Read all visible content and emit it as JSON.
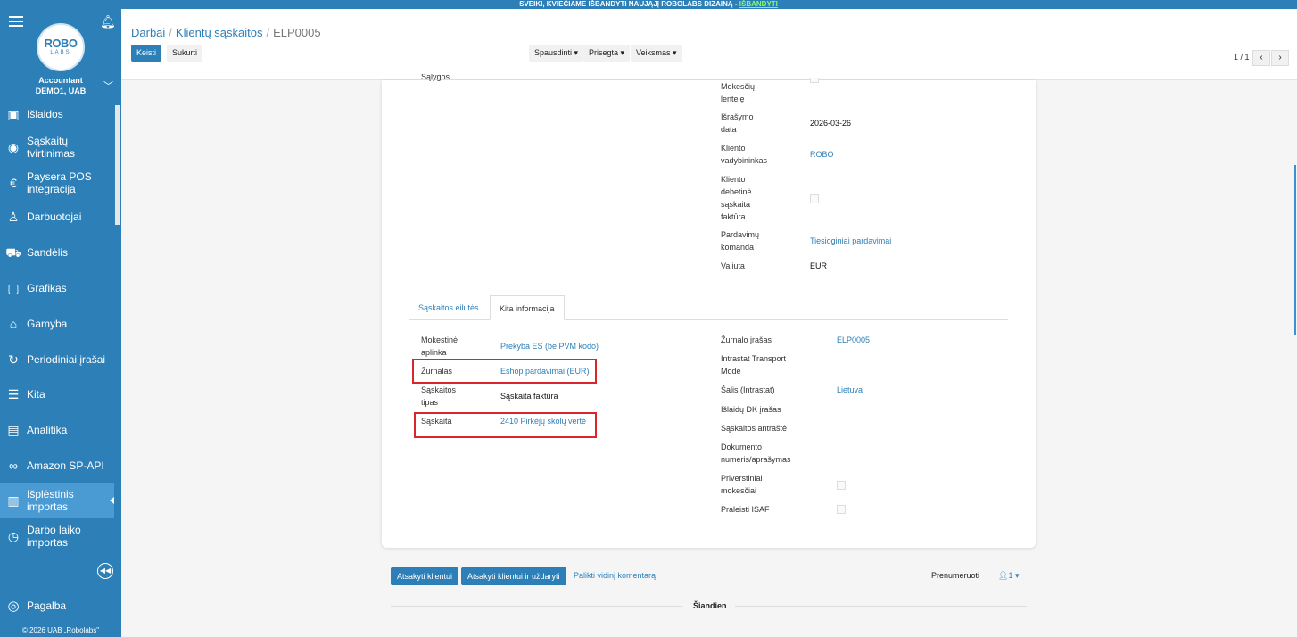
{
  "banner": {
    "text": "SVEIKI, KVIEČIAME IŠBANDYTI NAUJĄJĮ ROBOLABS DIZAINĄ - ",
    "link": "IŠBANDYTI"
  },
  "sidebar": {
    "logo_top": "ROBO",
    "logo_bottom": "LABS",
    "account_role": "Accountant",
    "account_company": "DEMO1, UAB",
    "items": [
      {
        "label": "Išlaidos",
        "icon": "receipt-icon"
      },
      {
        "label": "Sąskaitų tvirtinimas",
        "icon": "eye-icon"
      },
      {
        "label": "Paysera POS integracija",
        "icon": "euro-card-icon"
      },
      {
        "label": "Darbuotojai",
        "icon": "user-icon"
      },
      {
        "label": "Sandėlis",
        "icon": "truck-icon"
      },
      {
        "label": "Grafikas",
        "icon": "calendar-user-icon"
      },
      {
        "label": "Gamyba",
        "icon": "factory-icon"
      },
      {
        "label": "Periodiniai įrašai",
        "icon": "refresh-icon"
      },
      {
        "label": "Kita",
        "icon": "list-icon"
      },
      {
        "label": "Analitika",
        "icon": "analytics-icon"
      },
      {
        "label": "Amazon SP-API",
        "icon": "link-icon"
      },
      {
        "label": "Išplėstinis importas",
        "icon": "import-icon"
      },
      {
        "label": "Darbo laiko importas",
        "icon": "clock-icon"
      }
    ],
    "help": "Pagalba",
    "copyright": "© 2026 UAB „Robolabs\""
  },
  "header": {
    "breadcrumb": [
      "Darbai",
      "Klientų sąskaitos",
      "ELP0005"
    ],
    "edit": "Keisti",
    "create": "Sukurti",
    "print": "Spausdinti",
    "attached": "Prisegta",
    "actions": "Veiksmas",
    "pager": "1 / 1"
  },
  "upper_fields": {
    "left_partial": "Sąlygos",
    "tax_table": "Mokesčių lentelę",
    "invoice_date_label": "Išrašymo data",
    "invoice_date": "2026-03-26",
    "manager_label": "Kliento vadybininkas",
    "manager": "ROBO",
    "debit_label": "Kliento debetinė sąskaita faktūra",
    "team_label": "Pardavimų komanda",
    "team": "Tiesioginiai pardavimai",
    "currency_label": "Valiuta",
    "currency": "EUR"
  },
  "tabs": [
    "Sąskaitos eilutės",
    "Kita informacija"
  ],
  "other_info": {
    "tax_env_label": "Mokestinė aplinka",
    "tax_env": "Prekyba ES (be PVM kodo)",
    "journal_label": "Žurnalas",
    "journal": "Eshop pardavimai (EUR)",
    "invoice_type_label": "Sąskaitos tipas",
    "invoice_type": "Sąskaita faktūra",
    "account_label": "Sąskaita",
    "account": "2410 Pirkėjų skolų vertė",
    "journal_entry_label": "Žurnalo įrašas",
    "journal_entry": "ELP0005",
    "intrastat_mode_label": "Intrastat Transport Mode",
    "country_label": "Šalis (Intrastat)",
    "country": "Lietuva",
    "expense_label": "Išlaidų DK įrašas",
    "subtitle_label": "Sąskaitos antraštė",
    "docnum_label": "Dokumento numeris/aprašymas",
    "forced_tax_label": "Priverstiniai mokesčiai",
    "skip_isaf_label": "Praleisti ISAF"
  },
  "chatter": {
    "reply": "Atsakyti klientui",
    "reply_close": "Atsakyti klientui ir uždaryti",
    "note": "Palikti vidinį komentarą",
    "follow": "Prenumeruoti",
    "followers": "1",
    "today": "Šiandien"
  }
}
